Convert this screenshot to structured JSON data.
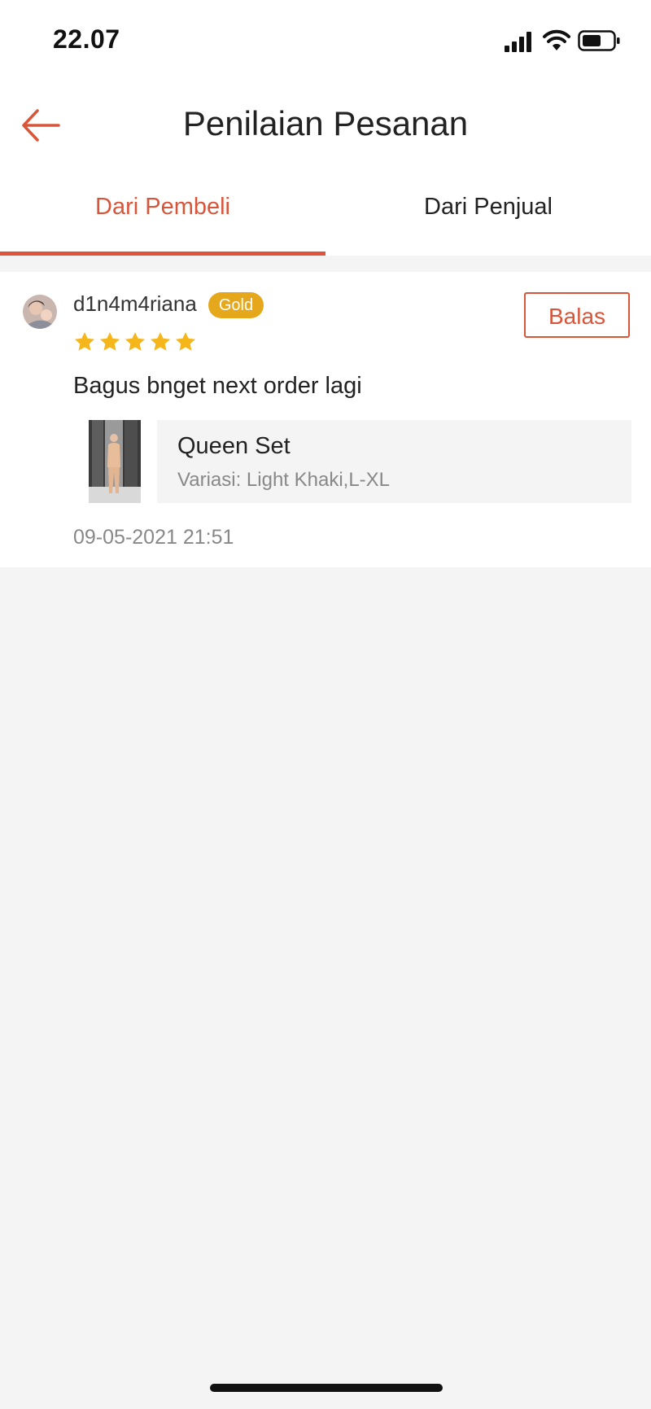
{
  "status_bar": {
    "time": "22.07"
  },
  "header": {
    "title": "Penilaian Pesanan"
  },
  "tabs": [
    {
      "label": "Dari Pembeli",
      "active": true
    },
    {
      "label": "Dari Penjual",
      "active": false
    }
  ],
  "review": {
    "username": "d1n4m4riana",
    "tier_badge": "Gold",
    "rating": 5,
    "rating_max": 5,
    "text": "Bagus bnget next order lagi",
    "reply_label": "Balas",
    "product": {
      "name": "Queen Set",
      "variation": "Variasi: Light Khaki,L-XL"
    },
    "date": "09-05-2021 21:51"
  },
  "colors": {
    "accent": "#d9553a",
    "badge_gold": "#e5a81c",
    "star": "#f5b61c"
  },
  "icons": [
    "signal-icon",
    "wifi-icon",
    "battery-icon",
    "back-arrow-icon",
    "star-icon"
  ]
}
